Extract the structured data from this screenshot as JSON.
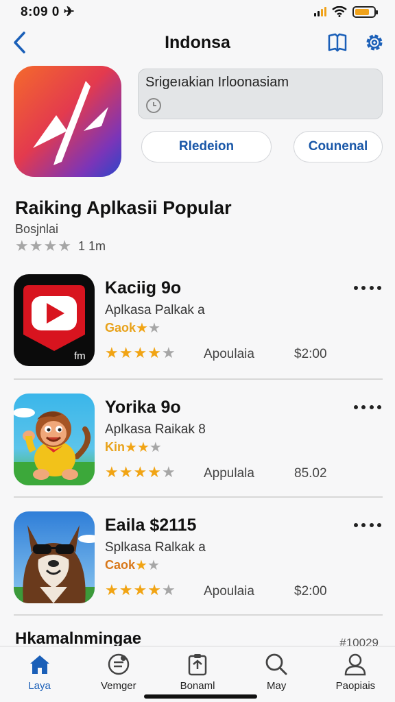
{
  "status": {
    "time": "8:09 0 ✈"
  },
  "nav": {
    "title": "Indonsa"
  },
  "hero": {
    "card_title": "Srigeıakian Irloonasiam"
  },
  "buttons": {
    "primary": "Rledeion",
    "secondary": "Counenal"
  },
  "section": {
    "title": "Raiking Aplkasii Popular",
    "subtitle": "Bosjnlai",
    "count": "1 1m",
    "stars": 4
  },
  "apps": [
    {
      "name": "Kaciig 9o",
      "sub": "Aplkasa Palkak a",
      "tag": "Gaok",
      "tag_stars": 2,
      "stars": 4,
      "category": "Apoulaia",
      "price": "$2:00",
      "icon": "red-play-icon",
      "icon_badge": "fm"
    },
    {
      "name": "Yorika 9o",
      "sub": "Aplkasa Raikak 8",
      "tag": "Kin",
      "tag_stars": 2,
      "stars": 4,
      "category": "Appulala",
      "price": "85.02",
      "icon": "cartoon-monkey-icon"
    },
    {
      "name": "Eaila $2115",
      "sub": "Splkasa Ralkak a",
      "tag": "Caok",
      "tag_stars": 1,
      "stars": 4,
      "category": "Apoulaia",
      "price": "$2:00",
      "icon": "cartoon-wolf-icon"
    }
  ],
  "bottom": {
    "heading": "Hkamalnmingae",
    "code": "#10029"
  },
  "tabs": [
    {
      "label": "Laya",
      "icon": "home-icon",
      "active": true
    },
    {
      "label": "Vemger",
      "icon": "compass-icon"
    },
    {
      "label": "Bonaml",
      "icon": "clipboard-icon"
    },
    {
      "label": "May",
      "icon": "search-icon"
    },
    {
      "label": "Paopiais",
      "icon": "profile-icon"
    }
  ],
  "colors": {
    "accent": "#1a5fb8",
    "star_gold": "#f1a414",
    "star_grey": "#a6a6a6",
    "battery": "#f0a21a"
  }
}
